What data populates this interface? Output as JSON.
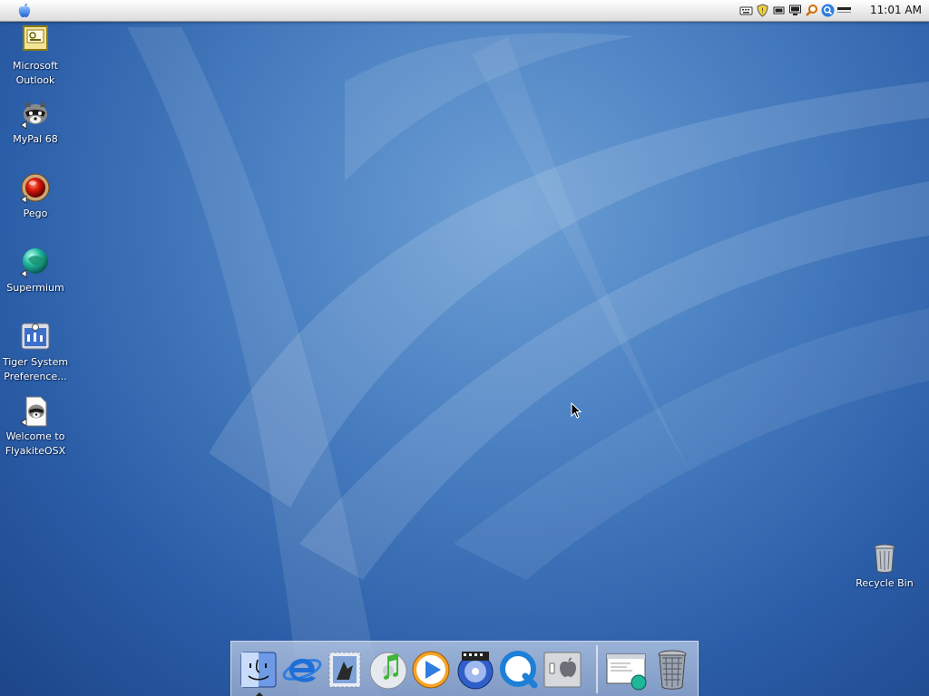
{
  "menubar": {
    "clock": "11:01 AM",
    "tray_icons": [
      "keyboard-icon",
      "shield-icon",
      "battery-icon",
      "monitor-icon",
      "magnifier-icon",
      "search-icon",
      "volume-icon"
    ]
  },
  "desktop_icons": [
    {
      "name": "microsoft-outlook",
      "label": "Microsoft Outlook",
      "icon": "outlook-icon"
    },
    {
      "name": "mypal-68",
      "label": "MyPal 68",
      "icon": "raccoon-icon"
    },
    {
      "name": "pego",
      "label": "Pego",
      "icon": "red-orb-icon"
    },
    {
      "name": "supermium",
      "label": "Supermium",
      "icon": "globe-icon"
    },
    {
      "name": "tiger-system-preferences",
      "label": "Tiger System Preference...",
      "icon": "system-preferences-icon"
    },
    {
      "name": "welcome-flyakite",
      "label": "Welcome to FlyakiteOSX",
      "icon": "document-raccoon-icon"
    },
    {
      "name": "recycle-bin",
      "label": "Recycle Bin",
      "icon": "trash-icon"
    }
  ],
  "dock": {
    "items": [
      "finder-icon",
      "internet-explorer-icon",
      "mail-stamp-icon",
      "itunes-icon",
      "media-player-icon",
      "dvd-player-icon",
      "quicktime-icon",
      "boot-camp-icon",
      "minimized-window-icon",
      "trash-icon"
    ]
  },
  "colors": {
    "desktop_blue": "#2b5ea8",
    "menubar": "#eeeeee",
    "label_text": "#ffffff"
  }
}
